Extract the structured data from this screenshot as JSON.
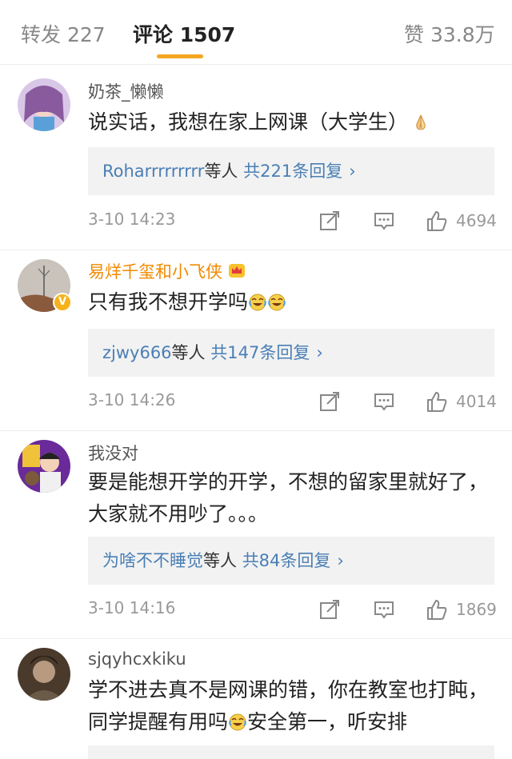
{
  "tabs": {
    "reposts": "转发 227",
    "comments": "评论 1507",
    "likes": "赞 33.8万"
  },
  "comments": [
    {
      "username": "奶茶_懒懒",
      "text": "说实话，我想在家上网课（大学生）",
      "emoji": "praying-hands-emoji",
      "replies_who": "Roharrrrrrrrr",
      "replies_mid": "等人",
      "replies_count": "共221条回复",
      "replies_arrow": "›",
      "time": "3-10 14:23",
      "likes": "4694"
    },
    {
      "username": "易烊千玺和小飞侠",
      "text": "只有我不想开学吗",
      "emoji": "laugh-cry-emoji",
      "replies_who": "zjwy666",
      "replies_mid": "等人",
      "replies_count": "共147条回复",
      "replies_arrow": "›",
      "time": "3-10 14:26",
      "likes": "4014",
      "verified_badge": "V"
    },
    {
      "username": "我没对",
      "text": "要是能想开学的开学，不想的留家里就好了，大家就不用吵了。。。",
      "replies_who": "为啥不不睡觉",
      "replies_mid": "等人",
      "replies_count": "共84条回复",
      "replies_arrow": "›",
      "time": "3-10 14:16",
      "likes": "1869"
    },
    {
      "username": "sjqyhcxkiku",
      "text_part1": "学不进去真不是网课的错，你在教室也打盹，同学提醒有用吗",
      "text_part2": "安全第一，听安排",
      "emoji": "laugh-cry-emoji"
    }
  ],
  "colors": {
    "accent": "#f5a623",
    "link": "#4a7fb5",
    "vip_name": "#f08a00",
    "reply_bg": "#f2f2f2"
  }
}
